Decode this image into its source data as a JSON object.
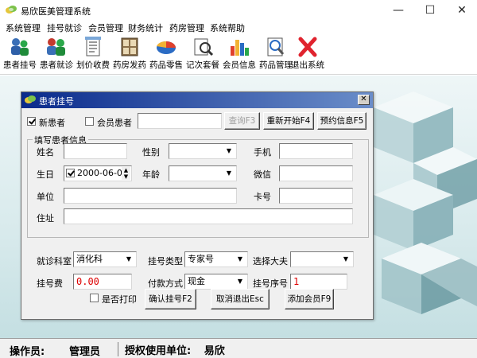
{
  "window": {
    "title": "易欣医美管理系统",
    "icon": "app-leaf-icon"
  },
  "menu": [
    "系统管理",
    "挂号就诊",
    "会员管理",
    "财务统计",
    "药房管理",
    "系统帮助"
  ],
  "toolbar": [
    {
      "label": "患者挂号",
      "icon": "patient-register-icon"
    },
    {
      "label": "患者就诊",
      "icon": "patient-visit-icon"
    },
    {
      "label": "划价收费",
      "icon": "billing-icon"
    },
    {
      "label": "药房发药",
      "icon": "pharmacy-dispense-icon"
    },
    {
      "label": "药品零售",
      "icon": "drug-retail-icon"
    },
    {
      "label": "记次套餐",
      "icon": "package-count-icon"
    },
    {
      "label": "会员信息",
      "icon": "member-info-icon"
    },
    {
      "label": "药品管理",
      "icon": "drug-management-icon"
    },
    {
      "label": "退出系统",
      "icon": "exit-icon"
    }
  ],
  "dialog": {
    "title": "患者挂号",
    "new_patient_label": "新患者",
    "new_patient_checked": true,
    "member_patient_label": "会员患者",
    "member_patient_checked": false,
    "member_search_value": "",
    "query_button": "查询F3",
    "restart_button": "重新开始F4",
    "appointment_button": "预约信息F5",
    "group_title": "填写患者信息",
    "fields": {
      "name_label": "姓名",
      "name_value": "",
      "gender_label": "性别",
      "gender_value": "",
      "phone_label": "手机",
      "phone_value": "",
      "birthday_label": "生日",
      "birthday_value": "2000-06-06",
      "birthday_checked": true,
      "age_label": "年龄",
      "age_value": "",
      "wechat_label": "微信",
      "wechat_value": "",
      "company_label": "单位",
      "company_value": "",
      "card_label": "卡号",
      "card_value": "",
      "address_label": "住址",
      "address_value": ""
    },
    "registration": {
      "department_label": "就诊科室",
      "department_value": "消化科",
      "reg_type_label": "挂号类型",
      "reg_type_value": "专家号",
      "doctor_label": "选择大夫",
      "doctor_value": "",
      "fee_label": "挂号费",
      "fee_value": "0.00",
      "payment_label": "付款方式",
      "payment_value": "现金",
      "seq_label": "挂号序号",
      "seq_value": "1",
      "print_label": "是否打印",
      "print_checked": false
    },
    "confirm_button": "确认挂号F2",
    "cancel_button": "取消退出Esc",
    "add_member_button": "添加会员F9"
  },
  "status": {
    "operator_label": "操作员:",
    "operator_value": "管理员",
    "licensee_label": "授权使用单位:",
    "licensee_value": "易欣"
  }
}
